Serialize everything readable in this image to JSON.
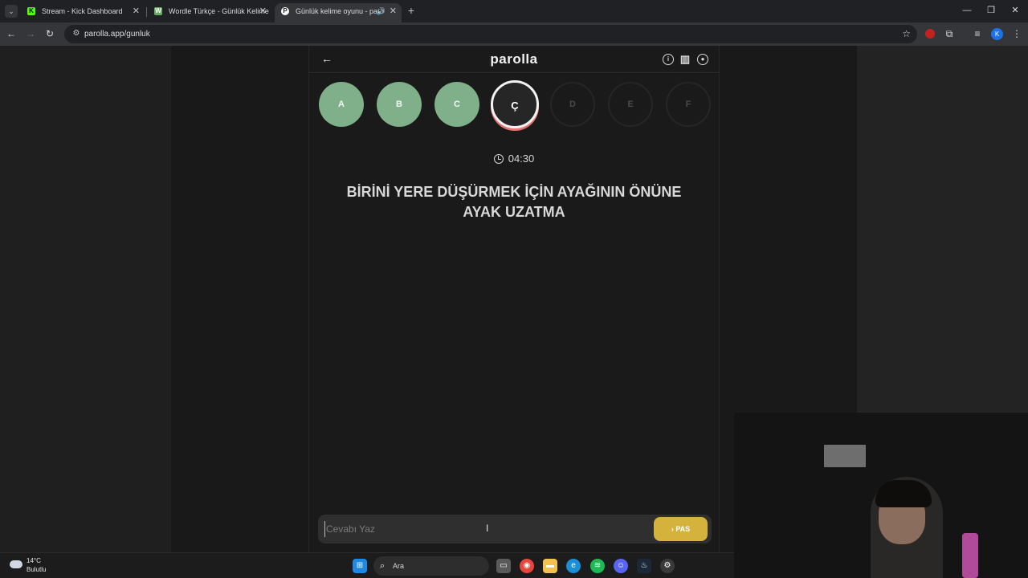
{
  "browser": {
    "tabs": [
      {
        "title": "Stream - Kick Dashboard",
        "favicon": "K",
        "favicon_color": "#53fc18"
      },
      {
        "title": "Wordle Türkçe - Günlük Kelime",
        "favicon": "W",
        "favicon_color": "#6aaa64"
      },
      {
        "title": "Günlük kelime oyunu - paro",
        "favicon": "P",
        "favicon_color": "#ffffff"
      }
    ],
    "url": "parolla.app/gunluk",
    "profile_initial": "K"
  },
  "app": {
    "logo": "parolla",
    "letters": [
      {
        "char": "A",
        "state": "done"
      },
      {
        "char": "B",
        "state": "done"
      },
      {
        "char": "C",
        "state": "done"
      },
      {
        "char": "Ç",
        "state": "current"
      },
      {
        "char": "D",
        "state": "pending"
      },
      {
        "char": "E",
        "state": "pending"
      },
      {
        "char": "F",
        "state": "pending"
      }
    ],
    "timer": "04:30",
    "question": "BİRİNİ YERE DÜŞÜRMEK İÇİN AYAĞININ ÖNÜNE AYAK UZATMA",
    "answer_placeholder": "Cevabı Yaz",
    "pass_label": "PAS",
    "accent_colors": {
      "done": "#7fb08a",
      "current_ring": "#e57373",
      "pass": "#d4b23c"
    }
  },
  "taskbar": {
    "weather_temp": "14°C",
    "weather_desc": "Bulutlu",
    "search_label": "Ara"
  }
}
